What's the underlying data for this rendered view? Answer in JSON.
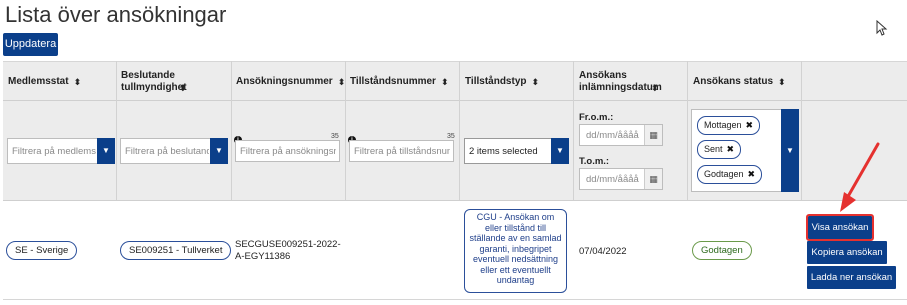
{
  "page": {
    "title": "Lista över ansökningar",
    "refresh_label": "Uppdatera"
  },
  "columns": [
    {
      "label": "Medlemsstat"
    },
    {
      "label": "Beslutande tullmyndighet"
    },
    {
      "label": "Ansökningsnummer"
    },
    {
      "label": "Tillståndsnummer"
    },
    {
      "label": "Tillståndstyp"
    },
    {
      "label": "Ansökans inlämningsdatum"
    },
    {
      "label": "Ansökans status"
    }
  ],
  "filters": {
    "member_state_placeholder": "Filtrera på medlemsstat",
    "customs_authority_placeholder": "Filtrera på beslutande tullmyndighet",
    "application_number_placeholder": "Filtrera på ansökningsnummer",
    "application_number_max": "35",
    "permit_number_placeholder": "Filtrera på tillståndsnummer",
    "permit_number_max": "35",
    "permit_type_selected": "2 items selected",
    "date_from_label": "Fr.o.m.:",
    "date_to_label": "T.o.m.:",
    "date_placeholder": "dd/mm/åååå",
    "status_chips": [
      "Mottagen",
      "Sent",
      "Godtagen"
    ]
  },
  "row": {
    "member_state": "SE - Sverige",
    "customs_authority": "SE009251 - Tullverket",
    "application_number_line1": "SECGUSE009251-2022-",
    "application_number_line2": "A-EGY11386",
    "permit_type_description": "CGU - Ansökan om eller tillstånd till ställande av en samlad garanti, inbegripet eventuell nedsättning eller ett eventuellt undantag",
    "submission_date": "07/04/2022",
    "status": "Godtagen",
    "actions": {
      "view": "Visa ansökan",
      "copy": "Kopiera ansökan",
      "download": "Ladda ner ansökan"
    }
  },
  "colors": {
    "primary": "#0b3f8a",
    "highlight": "#e5312f",
    "status_accepted": "#6a9a4a"
  }
}
